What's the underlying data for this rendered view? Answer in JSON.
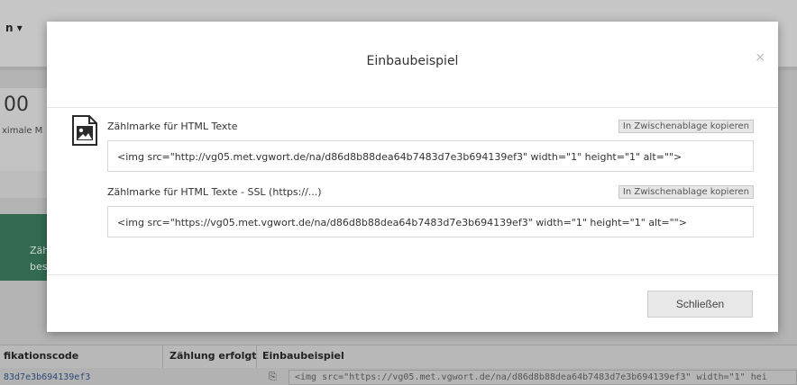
{
  "background": {
    "menu_label": "n ▾",
    "stat_value": "00",
    "stat_caption": "ximale M",
    "panel_text_1": "Zähl",
    "panel_text_2": "bes",
    "table": {
      "headers": [
        "fikationscode",
        "Zählung erfolgt",
        "Einbaubeispiel"
      ],
      "row_code": "83d7e3b694139ef3",
      "row_snippet": "<img src=\"https://vg05.met.vgwort.de/na/d86d8b88dea64b7483d7e3b694139ef3\" width=\"1\" hei"
    }
  },
  "modal": {
    "title": "Einbaubeispiel",
    "close_symbol": "×",
    "fields": [
      {
        "label": "Zählmarke für HTML Texte",
        "copy_label": "In Zwischenablage kopieren",
        "code": "<img src=\"http://vg05.met.vgwort.de/na/d86d8b88dea64b7483d7e3b694139ef3\" width=\"1\" height=\"1\" alt=\"\">"
      },
      {
        "label": "Zählmarke für HTML Texte - SSL (https://...)",
        "copy_label": "In Zwischenablage kopieren",
        "code": "<img src=\"https://vg05.met.vgwort.de/na/d86d8b88dea64b7483d7e3b694139ef3\" width=\"1\" height=\"1\" alt=\"\">"
      }
    ],
    "close_button_label": "Schließen",
    "icon": "image-icon"
  }
}
